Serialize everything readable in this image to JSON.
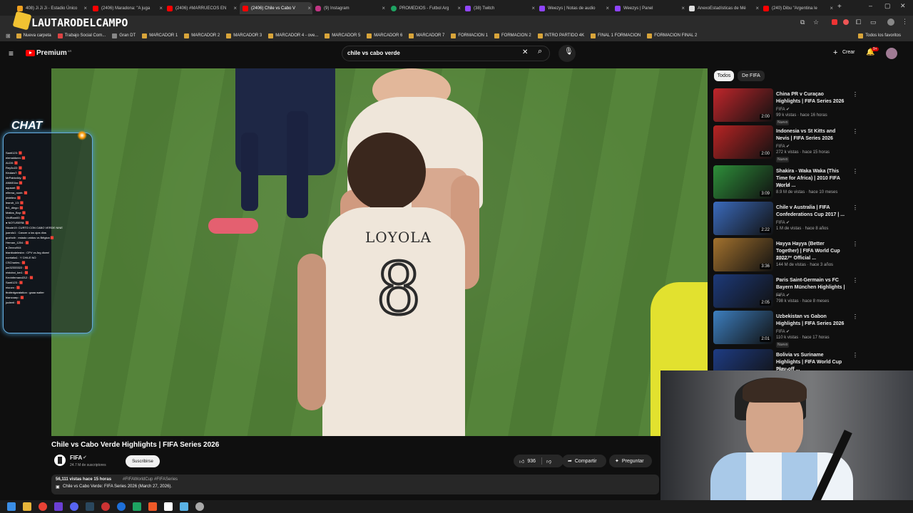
{
  "tabs": [
    {
      "label": "408) Ji Ji Ji - Estadio Único",
      "color": "#f0a020"
    },
    {
      "label": "(2406) Maradona: \"A juga",
      "color": "#ff0000"
    },
    {
      "label": "(2406) #MARRUECOS EN",
      "color": "#ff0000"
    },
    {
      "label": "(2406) Chile vs Cabo V",
      "color": "#ff0000"
    },
    {
      "label": "(9) Instagram",
      "color": "#c13584"
    },
    {
      "label": "PROMEDIOS - Futbol Arg",
      "color": "#1ea362"
    },
    {
      "label": "(38) Twitch",
      "color": "#9146ff"
    },
    {
      "label": "Weezys | Notas de audio",
      "color": "#8e44ff"
    },
    {
      "label": "Weezys | Panel",
      "color": "#8e44ff"
    },
    {
      "label": "AnexoEstadísticas de Mé",
      "color": "#dddddd"
    },
    {
      "label": "(240) Dibu \"Argentina le",
      "color": "#ff0000"
    }
  ],
  "bookmarks": [
    "Nueva carpeta",
    "Trabajo Social Com...",
    "Gran DT",
    "MARCADOR 1",
    "MARCADOR 2",
    "MARCADOR 3",
    "MARCADOR 4 - ove...",
    "MARCADOR 5",
    "MARCADOR 6",
    "MARCADOR 7",
    "FORMACION 1",
    "FORMACION 2",
    "INTRO PARTIDO 4K",
    "FINAL 1 FORMACION",
    "FORMACION FINAL 2"
  ],
  "bookmarks_right": "Todos los favoritos",
  "youtube": {
    "logo": "Premium",
    "logo_sup": "AR",
    "search_query": "chile vs cabo verde",
    "create_label": "Crear",
    "notif_count": "9+"
  },
  "overlay": {
    "channel_name": "LAUTARODELCAMPO",
    "chat_title": "CHAT",
    "chat_lines": [
      "Santi123: 🟥",
      "elemaldonn: 🟥",
      "ALD0: 🟥",
      "Rey3o22: 🟥",
      "Kindaw7: 🟥",
      "MrPablo4dy: 🟥",
      "ANM01ta: 🟥",
      "agusari: 🟥",
      "elferna_nonh: 🟥",
      "jrbleiteo: 🟥",
      "leandr_13: 🟥",
      "fb1_diego: 🟥",
      "Matios_Boy: 🟥",
      "ViniRam00: 🟥",
      "● NOTUSER8: 🟥",
      "Nicole19: CURTO CON CABO VERDE NINE",
      "juandu1 : Cancer a los ojos dios",
      "gozhollr : estado unidos vs Bélgica 🟥",
      "Hernan_1204 : 🟥",
      "● Zenno944",
      "blanitodelesbn : CPV vs Arg dicen!",
      "norrialta1 : Y CHILE NO",
      "CSCharles : 🟥",
      "jon32333322 : 🟥",
      "nistoboi_km1 : 🟥",
      "Kevinfernand212 : 🟥",
      "Santi123 : 🟥",
      "niuuvo : 🟥",
      "tboitedgaratation : gaaa walter",
      "blancoarp : 🟥",
      "jucleeii : 🟥"
    ]
  },
  "video": {
    "jersey_name": "LOYOLA",
    "jersey_number": "8",
    "title": "Chile vs Cabo Verde Highlights | FIFA Series 2026",
    "channel": "FIFA",
    "subscribers": "24.7 M de suscriptores",
    "subscribe_label": "Suscribirse",
    "likes": "936",
    "share_label": "Compartir",
    "ask_label": "Preguntar",
    "views_line": "56,111 vistas  hace 15 horas",
    "hashtags": "#FIFAWorldCup #FIFASeries",
    "description": "Chile vs Cabo Verde: FIFA Series 2026 (March 27, 2026)."
  },
  "chips": [
    "Todos",
    "De FIFA"
  ],
  "recommendations": [
    {
      "title": "China PR v Curaçao Highlights | FIFA Series 2026",
      "channel": "FIFA",
      "meta": "99 k vistas · hace 16 horas",
      "badge": "Nuevo",
      "duration": "2:00",
      "thumb": "#c0262b"
    },
    {
      "title": "Indonesia vs St Kitts and Nevis | FIFA Series 2026",
      "channel": "FIFA",
      "meta": "272 k vistas · hace 15 horas",
      "badge": "Nuevo",
      "duration": "2:00",
      "thumb": "#b82424"
    },
    {
      "title": "Shakira - Waka Waka (This Time for Africa) | 2010 FIFA World ...",
      "channel": "FIFA",
      "meta": "8.9 M de vistas · hace 10 meses",
      "badge": "",
      "duration": "3:09",
      "thumb": "#2e8f3a"
    },
    {
      "title": "Chile v Australia | FIFA Confederations Cup 2017 | ...",
      "channel": "FIFA",
      "meta": "1 M de vistas · hace 8 años",
      "badge": "",
      "duration": "2:22",
      "thumb": "#3b6bbd"
    },
    {
      "title": "Hayya Hayya (Better Together) | FIFA World Cup 2022™ Official ...",
      "channel": "FIFA",
      "meta": "144 M de vistas · hace 3 años",
      "badge": "",
      "duration": "3:36",
      "thumb": "#a3722e"
    },
    {
      "title": "Paris Saint-Germain vs FC Bayern München Highlights | ...",
      "channel": "FIFA",
      "meta": "798 k vistas · hace 8 meses",
      "badge": "",
      "duration": "2:05",
      "thumb": "#1d3a7a"
    },
    {
      "title": "Uzbekistan vs Gabon Highlights | FIFA Series 2026",
      "channel": "FIFA",
      "meta": "110 k vistas · hace 17 horas",
      "badge": "Nuevo",
      "duration": "2:01",
      "thumb": "#3d7fc0"
    },
    {
      "title": "Bolivia vs Suriname Highlights | FIFA World Cup Play-off ...",
      "channel": "FIFA",
      "meta": "",
      "badge": "",
      "duration": "",
      "thumb": "#1e3c84"
    }
  ],
  "colors": {
    "accent": "#ff0000",
    "bg": "#0f0f0f",
    "chat_border": "#6ad0ff"
  }
}
